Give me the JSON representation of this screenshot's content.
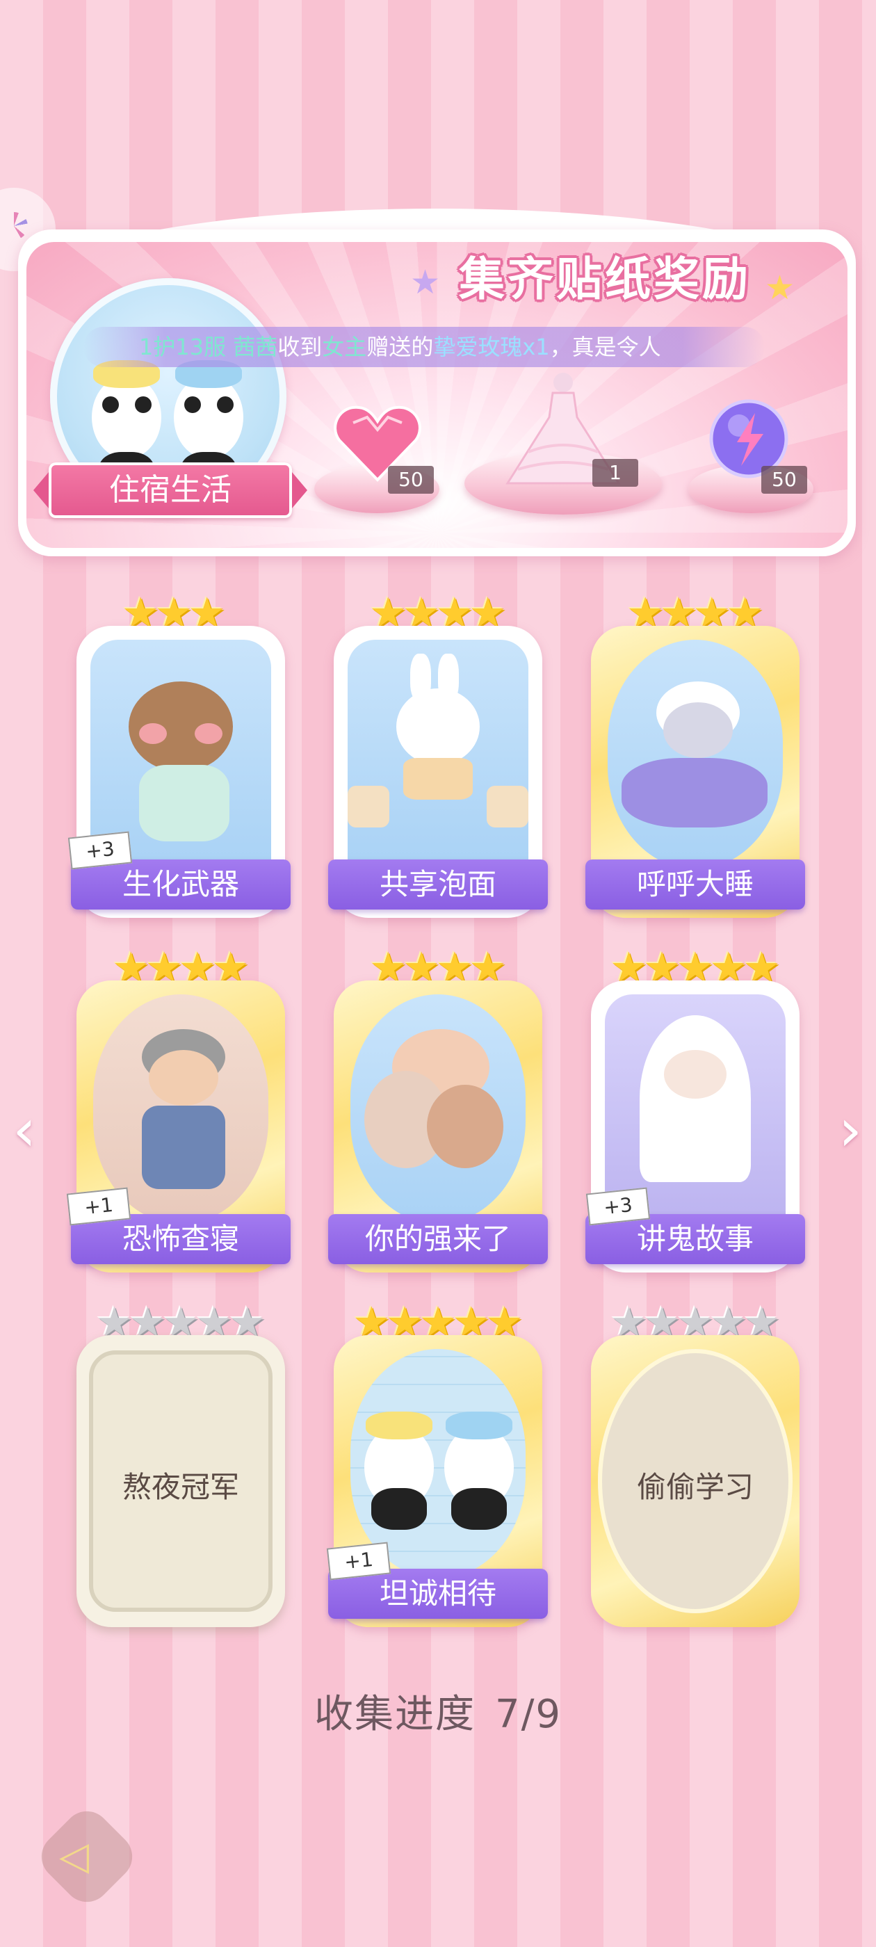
{
  "banner": {
    "title": "集齐贴纸奖励",
    "marquee": {
      "p1": "1护13服 ",
      "p2": "茜茜",
      "p3": "收到",
      "p4": "女主",
      "p5": "赠送的",
      "p6": "挚爱玫瑰x1",
      "p7": "，真是令人"
    },
    "album_label": "住宿生活",
    "rewards": [
      {
        "icon": "pink-heart-gem-icon",
        "count": "50"
      },
      {
        "icon": "gown-outfit-icon",
        "count": "1"
      },
      {
        "icon": "lightning-orb-icon",
        "count": "50"
      }
    ]
  },
  "stickers": [
    {
      "name": "生化武器",
      "stars": 3,
      "dup": "+3",
      "unlocked": true,
      "frame": "white"
    },
    {
      "name": "共享泡面",
      "stars": 4,
      "dup": "",
      "unlocked": true,
      "frame": "white"
    },
    {
      "name": "呼呼大睡",
      "stars": 4,
      "dup": "",
      "unlocked": true,
      "frame": "gold"
    },
    {
      "name": "恐怖查寝",
      "stars": 4,
      "dup": "+1",
      "unlocked": true,
      "frame": "gold"
    },
    {
      "name": "你的强来了",
      "stars": 4,
      "dup": "",
      "unlocked": true,
      "frame": "gold"
    },
    {
      "name": "讲鬼故事",
      "stars": 5,
      "dup": "+3",
      "unlocked": true,
      "frame": "white"
    },
    {
      "name": "熬夜冠军",
      "stars": 5,
      "dup": "",
      "unlocked": false,
      "frame": "plain"
    },
    {
      "name": "坦诚相待",
      "stars": 5,
      "dup": "+1",
      "unlocked": true,
      "frame": "gold"
    },
    {
      "name": "偷偷学习",
      "stars": 5,
      "dup": "",
      "unlocked": false,
      "frame": "gold"
    }
  ],
  "progress": {
    "label": "收集进度",
    "value": "7/9"
  },
  "nav": {
    "prev_icon": "chevron-left-icon",
    "next_icon": "chevron-right-icon",
    "back_icon": "back-arrow-icon"
  },
  "colors": {
    "accent_pink": "#e4588e",
    "label_purple": "#8a5fe3",
    "star_gold": "#ffcc2e"
  }
}
